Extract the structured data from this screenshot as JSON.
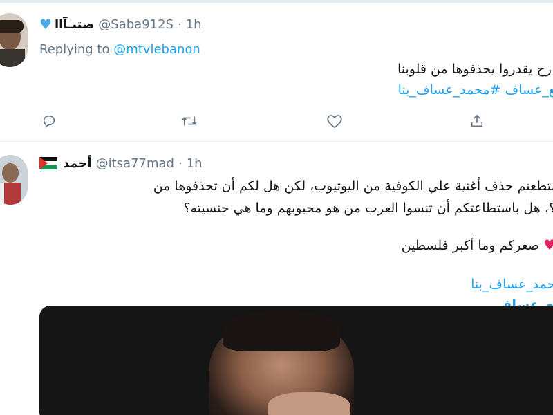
{
  "tweet1": {
    "display_name": "صتبـآاا",
    "handle": "@Saba912S",
    "time": "1h",
    "replying_label": "Replying to",
    "replying_to": "@mtvlebanon",
    "line1": "رح يقدروا يحذفوها من قلوبنا",
    "hashtags": "#مع_عساف #محمد_عساف_بنا"
  },
  "tweet2": {
    "display_name": "أحمد",
    "handle": "@itsa77mad",
    "time": "1h",
    "line1": "ا استطعتم حذف أغنية علي الكوفية من اليوتيوب، لكن هل لكم أن تحذفوها من",
    "line2": "وبنا؟، هل باستطاعتكم أن تنسوا العرب من هو محبوبهم وما هي جنسيته؟",
    "line3": "صغركم وما أكبر فلسطين",
    "hashtag1": "#محمد_عساف_بنا",
    "hashtag2": "#مع_عساف"
  },
  "icons": {
    "reply": "reply-icon",
    "retweet": "retweet-icon",
    "like": "like-icon",
    "share": "share-icon"
  },
  "colors": {
    "link": "#1da1f2",
    "muted": "#657786",
    "heart_blue": "#4aa9e9",
    "heart_red": "#e0245e"
  }
}
